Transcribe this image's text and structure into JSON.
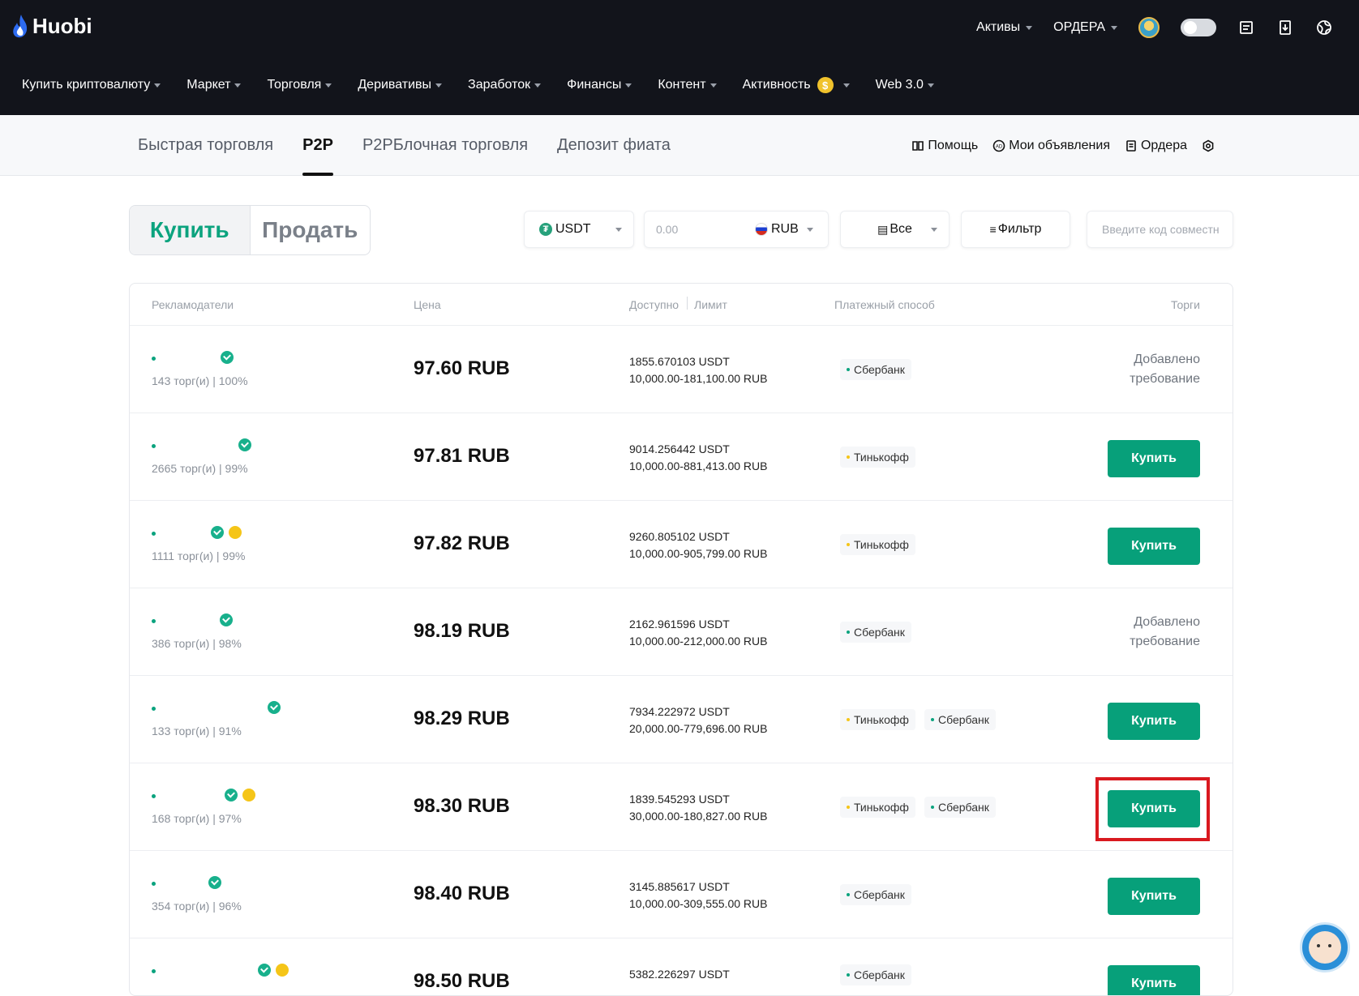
{
  "header": {
    "logo_text": "Huobi",
    "right_menu": [
      "Активы",
      "ОРДЕРА"
    ],
    "icons": [
      "avatar-icon",
      "toggle-icon",
      "orders-list-icon",
      "download-icon",
      "language-icon"
    ]
  },
  "main_nav": [
    {
      "label": "Купить криптовалюту"
    },
    {
      "label": "Маркет"
    },
    {
      "label": "Торговля"
    },
    {
      "label": "Деривативы"
    },
    {
      "label": "Заработок"
    },
    {
      "label": "Финансы"
    },
    {
      "label": "Контент"
    },
    {
      "label": "Активность",
      "badge": "$"
    },
    {
      "label": "Web 3.0"
    }
  ],
  "subnav": {
    "tabs": [
      "Быстрая торговля",
      "P2P",
      "P2PБлочная торговля",
      "Депозит фиата"
    ],
    "active_tab": "P2P",
    "links": [
      "Помощь",
      "Мои объявления",
      "Ордера"
    ]
  },
  "trade_side": {
    "buy": "Купить",
    "sell": "Продать",
    "selected": "Купить"
  },
  "filters": {
    "crypto": "USDT",
    "amount_placeholder": "0.00",
    "fiat": "RUB",
    "payment": "Все",
    "filter_label": "Фильтр",
    "code_placeholder": "Введите код совместн"
  },
  "table": {
    "headers": {
      "advertisers": "Рекламодатели",
      "price": "Цена",
      "available": "Доступно",
      "limit": "Лимит",
      "payment": "Платежный способ",
      "trade": "Торги"
    },
    "rows": [
      {
        "stats": "143 торг(и) | 100%",
        "price": "97.60 RUB",
        "available": "1855.670103 USDT",
        "limit": "10,000.00-181,100.00 RUB",
        "payments": [
          "Сбербанк"
        ],
        "action": "note",
        "note1": "Добавлено",
        "note2": "требование"
      },
      {
        "stats": "2665 торг(и) | 99%",
        "price": "97.81 RUB",
        "available": "9014.256442 USDT",
        "limit": "10,000.00-881,413.00 RUB",
        "payments": [
          "Тинькофф"
        ],
        "action": "Купить"
      },
      {
        "stats": "1111 торг(и) | 99%",
        "price": "97.82 RUB",
        "available": "9260.805102 USDT",
        "limit": "10,000.00-905,799.00 RUB",
        "payments": [
          "Тинькофф"
        ],
        "action": "Купить"
      },
      {
        "stats": "386 торг(и) | 98%",
        "price": "98.19 RUB",
        "available": "2162.961596 USDT",
        "limit": "10,000.00-212,000.00 RUB",
        "payments": [
          "Сбербанк"
        ],
        "action": "note",
        "note1": "Добавлено",
        "note2": "требование"
      },
      {
        "stats": "133 торг(и) | 91%",
        "price": "98.29 RUB",
        "available": "7934.222972 USDT",
        "limit": "20,000.00-779,696.00 RUB",
        "payments": [
          "Тинькофф",
          "Сбербанк"
        ],
        "action": "Купить"
      },
      {
        "stats": "168 торг(и) | 97%",
        "price": "98.30 RUB",
        "available": "1839.545293 USDT",
        "limit": "30,000.00-180,827.00 RUB",
        "payments": [
          "Тинькофф",
          "Сбербанк"
        ],
        "action": "Купить"
      },
      {
        "stats": "354 торг(и) | 96%",
        "price": "98.40 RUB",
        "available": "3145.885617 USDT",
        "limit": "10,000.00-309,555.00 RUB",
        "payments": [
          "Сбербанк"
        ],
        "action": "Купить"
      },
      {
        "stats": "",
        "price": "98.50 RUB",
        "available": "5382.226297 USDT",
        "limit": "",
        "payments": [
          "Сбербанк"
        ],
        "action": "Купить"
      }
    ]
  },
  "colors": {
    "accent": "#07a07a",
    "header_bg": "#12141b",
    "highlight": "#d9191f",
    "tinkoff_dot": "#f5c518",
    "sber_dot": "#0ba37e"
  }
}
